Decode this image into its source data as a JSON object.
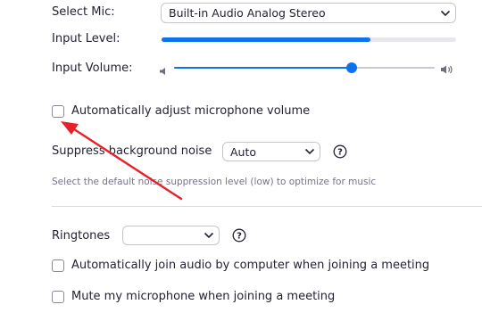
{
  "audio": {
    "select_mic_label": "Select Mic:",
    "mic_device": "Built-in Audio Analog Stereo",
    "input_level_label": "Input Level:",
    "input_level_fraction": 0.71,
    "input_volume_label": "Input Volume:",
    "input_volume_fraction": 0.68,
    "auto_adjust_label": "Automatically adjust microphone volume",
    "auto_adjust_checked": false
  },
  "noise": {
    "label": "Suppress background noise",
    "value": "Auto",
    "hint": "Select the default noise suppression level (low) to optimize for music"
  },
  "ringtones": {
    "label": "Ringtones",
    "value": ""
  },
  "options": {
    "auto_join_label": "Automatically join audio by computer when joining a meeting",
    "auto_join_checked": false,
    "mute_on_join_label": "Mute my microphone when joining a meeting",
    "mute_on_join_checked": false
  },
  "colors": {
    "accent": "#0e72ed",
    "arrow": "#e8202a"
  }
}
